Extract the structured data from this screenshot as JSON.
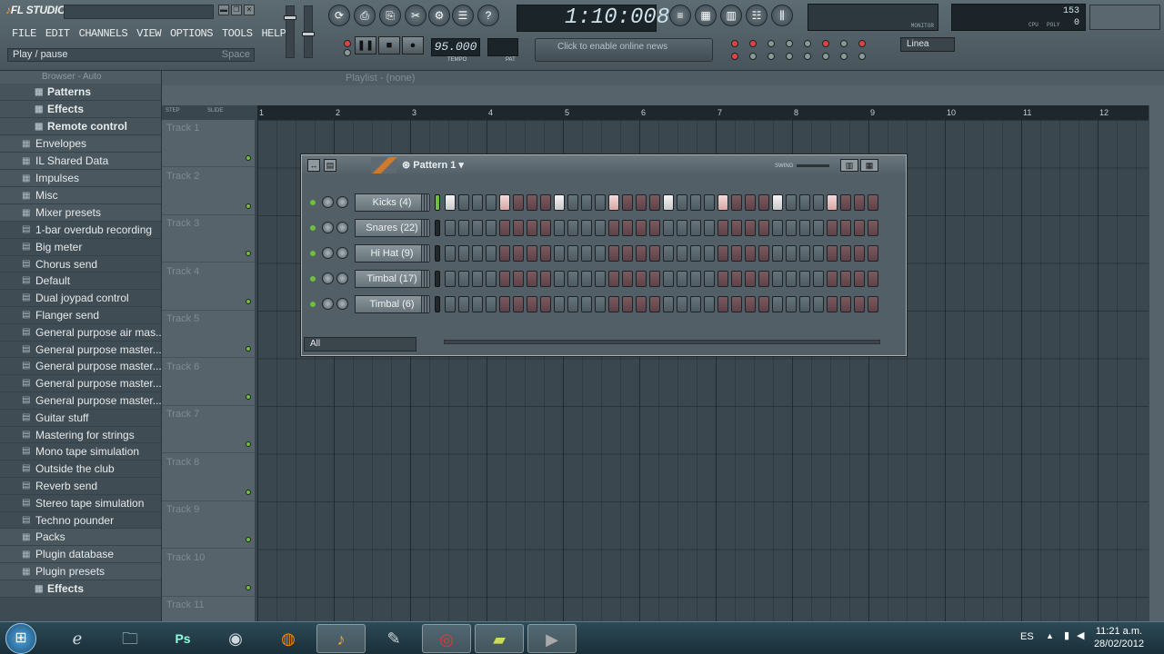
{
  "app": {
    "logo": "FL STUDIO"
  },
  "menu": [
    "FILE",
    "EDIT",
    "CHANNELS",
    "VIEW",
    "OPTIONS",
    "TOOLS",
    "HELP"
  ],
  "hint": {
    "text": "Play / pause",
    "key": "Space"
  },
  "time_display": "1:10:008",
  "tempo": "95.000",
  "tempo_label": "TEMPO",
  "pattern_label": "PAT",
  "news": "Click to enable online news",
  "snap": "Linea",
  "cpu": {
    "value": "153",
    "poly": "0",
    "label_cpu": "CPU",
    "label_poly": "POLY"
  },
  "monitor_label": "MONITOR",
  "browser": {
    "title": "Browser - Auto",
    "items": [
      {
        "label": "Patterns",
        "kind": "sub"
      },
      {
        "label": "Effects",
        "kind": "sub"
      },
      {
        "label": "Remote control",
        "kind": "sub"
      },
      {
        "label": "Envelopes",
        "kind": "folder"
      },
      {
        "label": "IL Shared Data",
        "kind": "folder"
      },
      {
        "label": "Impulses",
        "kind": "folder"
      },
      {
        "label": "Misc",
        "kind": "folder"
      },
      {
        "label": "Mixer presets",
        "kind": "folder"
      },
      {
        "label": "1-bar overdub recording",
        "kind": "file"
      },
      {
        "label": "Big meter",
        "kind": "file"
      },
      {
        "label": "Chorus send",
        "kind": "file"
      },
      {
        "label": "Default",
        "kind": "file"
      },
      {
        "label": "Dual joypad control",
        "kind": "file"
      },
      {
        "label": "Flanger send",
        "kind": "file"
      },
      {
        "label": "General purpose air mas...",
        "kind": "file"
      },
      {
        "label": "General purpose master...",
        "kind": "file"
      },
      {
        "label": "General purpose master...",
        "kind": "file"
      },
      {
        "label": "General purpose master...",
        "kind": "file"
      },
      {
        "label": "General purpose master...",
        "kind": "file"
      },
      {
        "label": "Guitar stuff",
        "kind": "file"
      },
      {
        "label": "Mastering for strings",
        "kind": "file"
      },
      {
        "label": "Mono tape simulation",
        "kind": "file"
      },
      {
        "label": "Outside the club",
        "kind": "file"
      },
      {
        "label": "Reverb send",
        "kind": "file"
      },
      {
        "label": "Stereo tape simulation",
        "kind": "file"
      },
      {
        "label": "Techno pounder",
        "kind": "file"
      },
      {
        "label": "Packs",
        "kind": "folder"
      },
      {
        "label": "Plugin database",
        "kind": "folder"
      },
      {
        "label": "Plugin presets",
        "kind": "folder"
      },
      {
        "label": "Effects",
        "kind": "sub"
      }
    ]
  },
  "playlist": {
    "title": "Playlist - (none)",
    "ruler": [
      "1",
      "2",
      "3",
      "4",
      "5",
      "6",
      "7",
      "8",
      "9",
      "10",
      "11",
      "12"
    ],
    "step_labels": [
      "STEP",
      "SLIDE"
    ],
    "tracks": [
      "Track 1",
      "Track 2",
      "Track 3",
      "Track 4",
      "Track 5",
      "Track 6",
      "Track 7",
      "Track 8",
      "Track 9",
      "Track 10",
      "Track 11"
    ]
  },
  "stepseq": {
    "title": "Pattern 1",
    "swing_label": "SWING",
    "filter": "All",
    "channels": [
      {
        "name": "Kicks (4)",
        "selected": true,
        "steps": [
          1,
          0,
          0,
          0,
          1,
          0,
          0,
          0,
          1,
          0,
          0,
          0,
          1,
          0,
          0,
          0,
          1,
          0,
          0,
          0,
          1,
          0,
          0,
          0,
          1,
          0,
          0,
          0,
          1,
          0,
          0,
          0
        ]
      },
      {
        "name": "Snares (22)",
        "selected": false,
        "steps": [
          0,
          0,
          0,
          0,
          0,
          0,
          0,
          0,
          0,
          0,
          0,
          0,
          0,
          0,
          0,
          0,
          0,
          0,
          0,
          0,
          0,
          0,
          0,
          0,
          0,
          0,
          0,
          0,
          0,
          0,
          0,
          0
        ]
      },
      {
        "name": "Hi Hat (9)",
        "selected": false,
        "steps": [
          0,
          0,
          0,
          0,
          0,
          0,
          0,
          0,
          0,
          0,
          0,
          0,
          0,
          0,
          0,
          0,
          0,
          0,
          0,
          0,
          0,
          0,
          0,
          0,
          0,
          0,
          0,
          0,
          0,
          0,
          0,
          0
        ]
      },
      {
        "name": "Timbal (17)",
        "selected": false,
        "steps": [
          0,
          0,
          0,
          0,
          0,
          0,
          0,
          0,
          0,
          0,
          0,
          0,
          0,
          0,
          0,
          0,
          0,
          0,
          0,
          0,
          0,
          0,
          0,
          0,
          0,
          0,
          0,
          0,
          0,
          0,
          0,
          0
        ]
      },
      {
        "name": "Timbal (6)",
        "selected": false,
        "steps": [
          0,
          0,
          0,
          0,
          0,
          0,
          0,
          0,
          0,
          0,
          0,
          0,
          0,
          0,
          0,
          0,
          0,
          0,
          0,
          0,
          0,
          0,
          0,
          0,
          0,
          0,
          0,
          0,
          0,
          0,
          0,
          0
        ]
      }
    ]
  },
  "taskbar": {
    "apps": [
      "start-orb",
      "internet-explorer",
      "file-explorer",
      "photoshop",
      "media-player",
      "firefox",
      "fl-studio",
      "notepad",
      "chrome",
      "sticky-notes",
      "video-app"
    ],
    "lang": "ES",
    "time": "11:21 a.m.",
    "date": "28/02/2012"
  }
}
